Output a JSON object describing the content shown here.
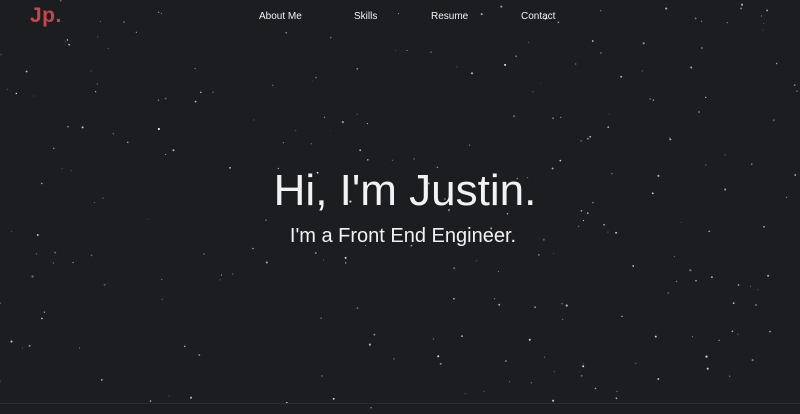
{
  "header": {
    "logo": "Jp.",
    "nav": {
      "about": "About Me",
      "skills": "Skills",
      "resume": "Resume",
      "contact": "Contact"
    }
  },
  "hero": {
    "title": "Hi, I'm Justin.",
    "subtitle": "I'm a Front End Engineer."
  },
  "colors": {
    "background": "#1c1d21",
    "logo_accent": "#c9464b",
    "text": "#f2f2f2"
  }
}
